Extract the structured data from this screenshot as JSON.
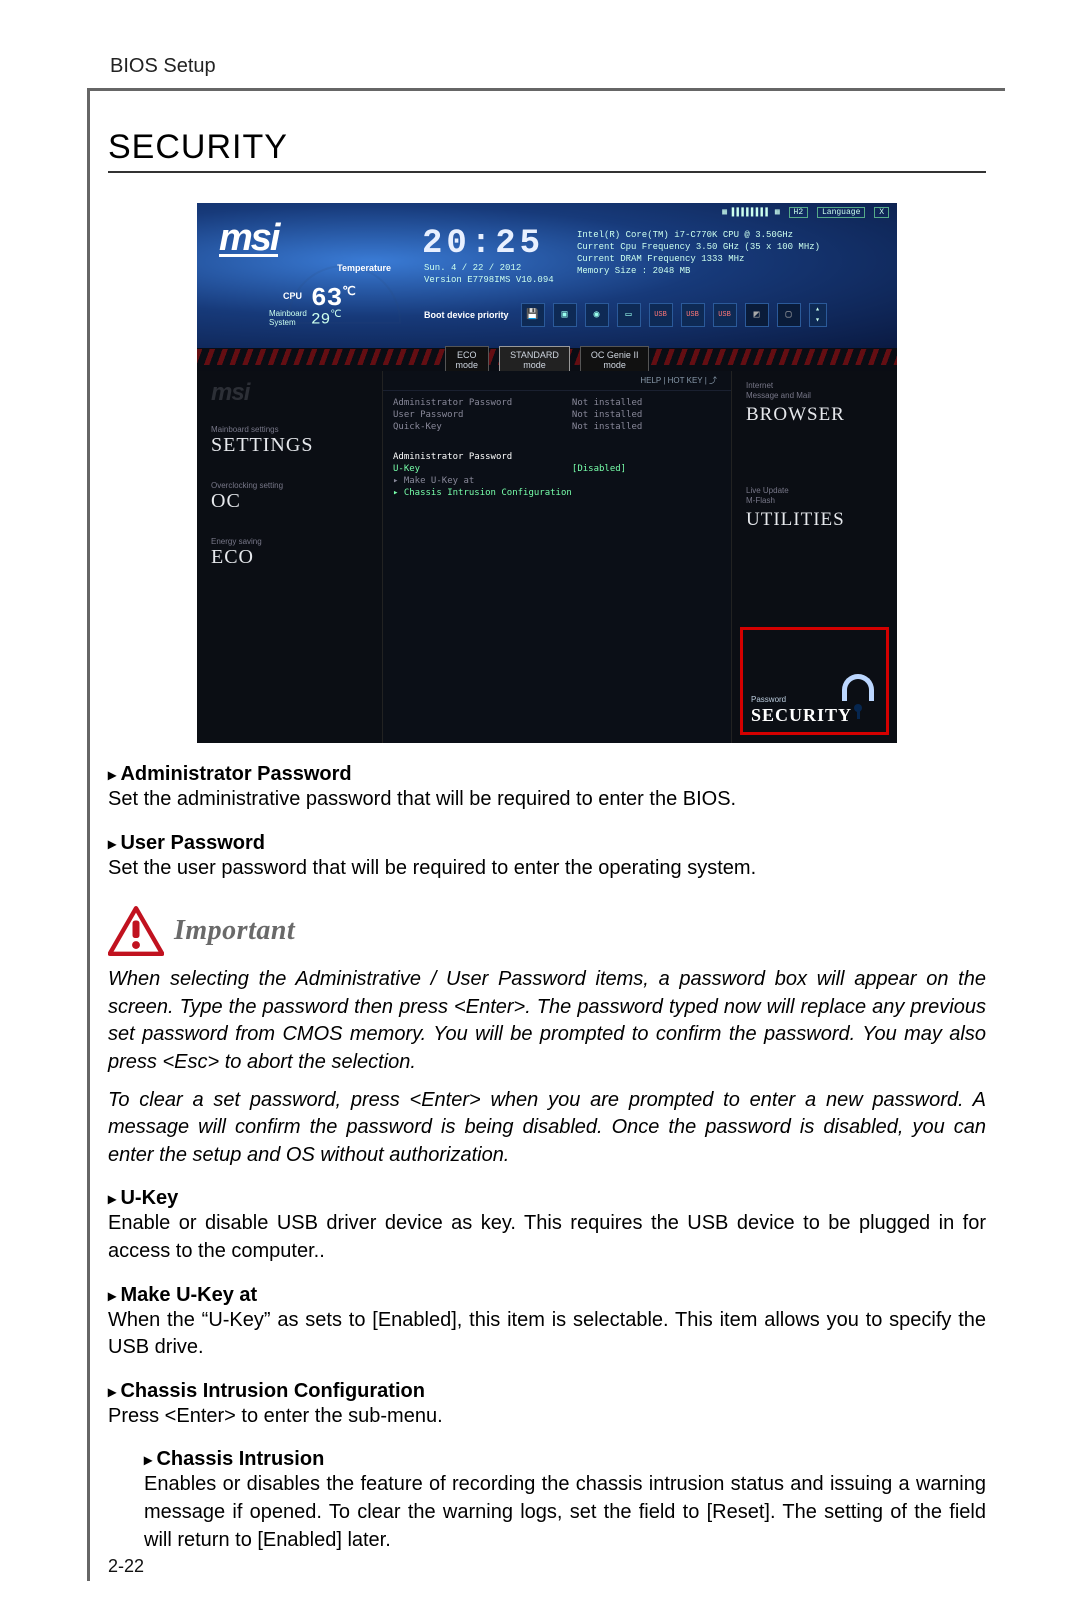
{
  "doc": {
    "header": "BIOS Setup",
    "section_title": "SECURITY",
    "page_number": "2-22"
  },
  "bios": {
    "logo": "msi",
    "topbar": {
      "help": "H2",
      "lang": "Language",
      "close": "X"
    },
    "clock": "20:25",
    "clock_date": "Sun.  4 / 22 / 2012",
    "clock_version": "Version E7798IMS V10.094",
    "temp": {
      "label": "Temperature",
      "cpu_lbl": "CPU",
      "cpu": "63",
      "mb_lbl": "Mainboard\nSystem",
      "mb": "29"
    },
    "sysinfo": [
      "Intel(R) Core(TM) i7-C770K CPU @ 3.50GHz",
      "Current Cpu Frequency 3.50 GHz (35 x 100 MHz)",
      "Current DRAM Frequency 1333 MHz",
      "Memory Size : 2048 MB"
    ],
    "boot_label": "Boot device priority",
    "modes": {
      "eco": "ECO\nmode",
      "std": "STANDARD\nmode",
      "oc": "OC Genie II\nmode"
    },
    "left_nav": {
      "a_sup": "Mainboard settings",
      "a": "SETTINGS",
      "b_sup": "Overclocking setting",
      "b": "OC",
      "c_sup": "Energy saving",
      "c": "ECO"
    },
    "help_line": "HELP  |  HOT KEY  |  ⤴",
    "list_top": [
      {
        "k": "Administrator Password",
        "v": "Not installed"
      },
      {
        "k": "User Password",
        "v": "Not installed"
      },
      {
        "k": "Quick-Key",
        "v": "Not installed"
      }
    ],
    "list_mid": [
      {
        "k": "Administrator Password",
        "v": ""
      },
      {
        "k": "U-Key",
        "v": "[Disabled]"
      },
      {
        "k": "Make U-Key at",
        "v": "",
        "arrow": true
      },
      {
        "k": "Chassis Intrusion Configuration",
        "v": "",
        "arrow": true
      }
    ],
    "right": {
      "a_sup": "Internet\nMessage and Mail",
      "a": "BROWSER",
      "b_sup": "Live Update\nM-Flash",
      "b": "UTILITIES",
      "sec_pw": "Password",
      "sec": "SECURITY"
    }
  },
  "items": {
    "admin_hdr": "Administrator Password",
    "admin_txt": "Set the administrative password that will be required to enter the BIOS.",
    "user_hdr": "User Password",
    "user_txt": "Set the user password that will be required to enter the operating system.",
    "important": "Important",
    "note1": "When selecting the Administrative / User Password items, a password box will appear on the screen. Type the password then press <Enter>. The password typed now will replace any previous set password from CMOS memory. You will be prompted to confirm the password. You may also press <Esc> to abort the selection.",
    "note2": "To clear a set password, press <Enter> when you are prompted to enter a new password. A message will confirm the password is being disabled. Once the password is disabled, you can enter the setup and OS without authorization.",
    "ukey_hdr": "U-Key",
    "ukey_txt": "Enable or disable USB driver device as key. This requires the USB device to be plugged in for access to the computer..",
    "make_hdr": "Make U-Key at",
    "make_txt": "When the “U-Key” as sets to [Enabled], this item is selectable. This item allows you to specify the USB drive.",
    "chassis_hdr": "Chassis Intrusion Configuration",
    "chassis_txt": "Press <Enter> to enter the sub-menu.",
    "cintr_hdr": "Chassis Intrusion",
    "cintr_txt": "Enables or disables the feature of recording the chassis intrusion status and issuing a warning message if opened. To clear the warning logs, set the field to [Reset]. The setting of the field will return to [Enabled] later."
  }
}
